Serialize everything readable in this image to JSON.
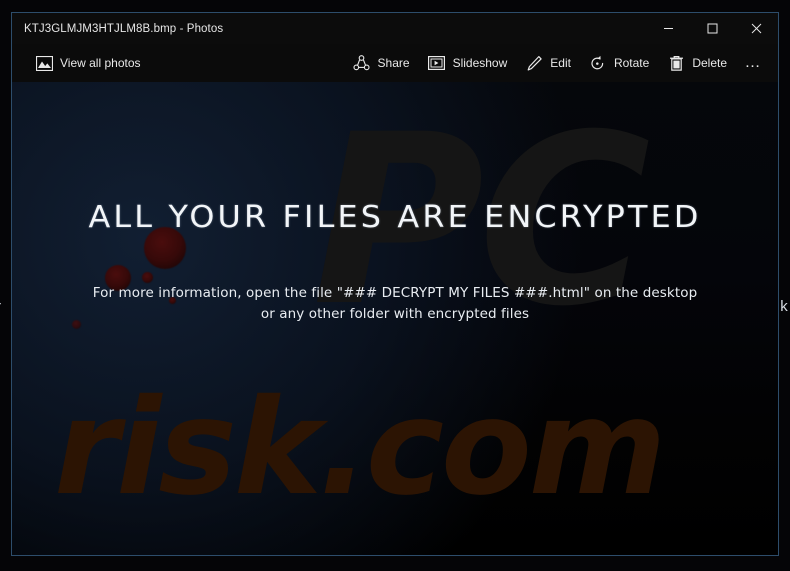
{
  "desktop": {
    "left_edge_text": "r",
    "right_edge_text": "k"
  },
  "window": {
    "title": "KTJ3GLMJM3HTJLM8B.bmp - Photos",
    "controls": {
      "minimize_label": "Minimize",
      "maximize_label": "Maximize",
      "close_label": "Close"
    }
  },
  "toolbar": {
    "view_all_photos": {
      "label": "View all photos",
      "icon": "picture-icon"
    },
    "actions": [
      {
        "label": "Share",
        "icon": "share-icon"
      },
      {
        "label": "Slideshow",
        "icon": "slideshow-icon"
      },
      {
        "label": "Edit",
        "icon": "pencil-edit-icon"
      },
      {
        "label": "Rotate",
        "icon": "rotate-icon"
      },
      {
        "label": "Delete",
        "icon": "trash-delete-icon"
      }
    ],
    "more_label": "…",
    "more_icon": "ellipsis-icon"
  },
  "image": {
    "heading": "ALL YOUR FILES ARE ENCRYPTED",
    "body_line_1": "For more information, open the file \"### DECRYPT MY FILES ###.html\" on the desktop",
    "body_line_2": "or any other folder with encrypted files",
    "watermark_pc": "PC",
    "watermark_risk": "risk.com"
  },
  "colors": {
    "window_border": "#2d4d6b",
    "titlebar_bg": "#0c0c0c",
    "toolbar_bg": "#0b0b0b",
    "image_bg": "#000000",
    "heading_text": "#f2f5f8",
    "watermark_pc": "#151515",
    "watermark_risk": "#2c1403",
    "blue_glow": "#12203 4",
    "blob_red": "#4a0d0d"
  }
}
